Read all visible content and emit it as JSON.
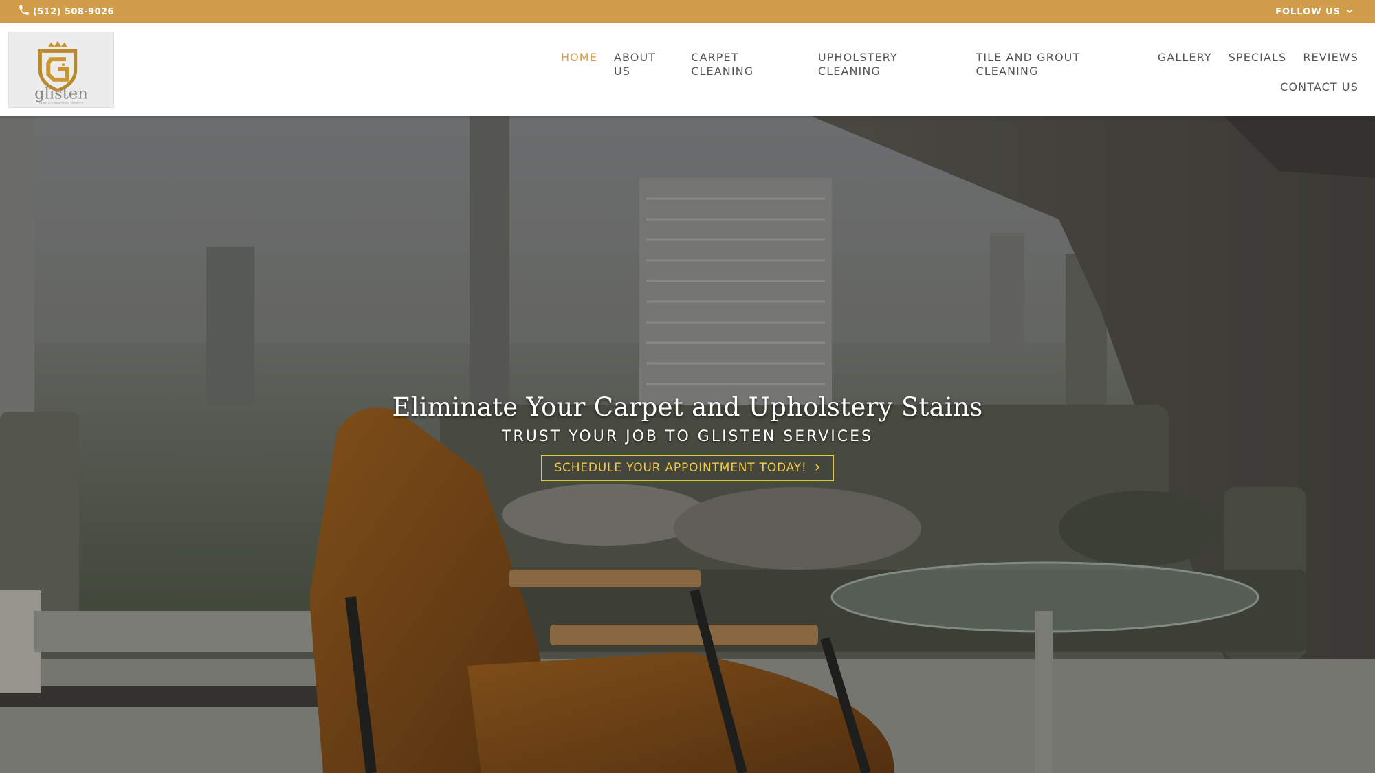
{
  "topbar": {
    "phone": "(512) 508-9026",
    "follow_label": "FOLLOW US",
    "color": "#d19d4a"
  },
  "logo": {
    "wordmark": "glisten",
    "tagline": "HOME & COMMERCIAL SERVICES"
  },
  "nav": {
    "items": [
      {
        "label": "HOME",
        "active": true
      },
      {
        "label": "ABOUT US"
      },
      {
        "label": "CARPET CLEANING"
      },
      {
        "label": "UPHOLSTERY CLEANING"
      },
      {
        "label": "TILE AND GROUT CLEANING"
      },
      {
        "label": "GALLERY"
      },
      {
        "label": "SPECIALS"
      },
      {
        "label": "REVIEWS"
      },
      {
        "label": "CONTACT US"
      }
    ],
    "active_color": "#d19d4a"
  },
  "hero": {
    "title": "Eliminate Your Carpet and Upholstery Stains",
    "subtitle": "TRUST YOUR JOB TO GLISTEN SERVICES",
    "cta_label": "SCHEDULE YOUR APPOINTMENT TODAY!",
    "cta_color": "#f0cb43"
  },
  "icons": [
    "phone-icon",
    "chevron-down-icon",
    "chevron-right-icon"
  ]
}
